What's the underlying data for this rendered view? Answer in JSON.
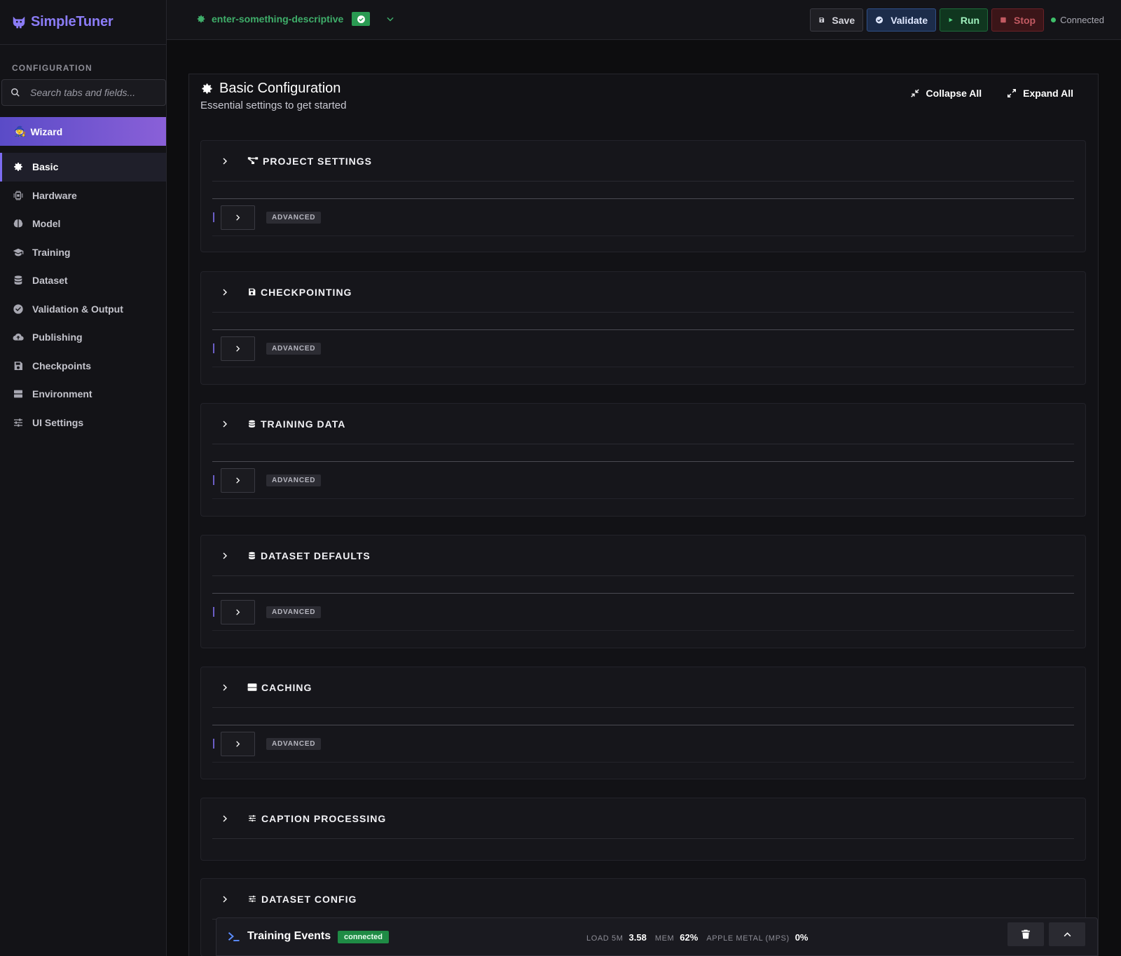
{
  "brand": {
    "name": "SimpleTuner",
    "color": "#8b7cf6"
  },
  "sidebar": {
    "section_label": "CONFIGURATION",
    "search_placeholder": "Search tabs and fields...",
    "wizard_label": "Wizard",
    "items": [
      {
        "label": "Basic",
        "icon": "gear-icon",
        "active": true
      },
      {
        "label": "Hardware",
        "icon": "chip-icon"
      },
      {
        "label": "Model",
        "icon": "brain-icon"
      },
      {
        "label": "Training",
        "icon": "graduation-cap-icon"
      },
      {
        "label": "Dataset",
        "icon": "database-icon"
      },
      {
        "label": "Validation & Output",
        "icon": "check-circle-icon"
      },
      {
        "label": "Publishing",
        "icon": "cloud-upload-icon"
      },
      {
        "label": "Checkpoints",
        "icon": "floppy-icon"
      },
      {
        "label": "Environment",
        "icon": "server-icon"
      },
      {
        "label": "UI Settings",
        "icon": "sliders-icon"
      }
    ]
  },
  "topbar": {
    "config_name": "enter-something-descriptive",
    "save_label": "Save",
    "validate_label": "Validate",
    "run_label": "Run",
    "stop_label": "Stop",
    "status_label": "Connected"
  },
  "panel": {
    "title": "Basic Configuration",
    "subtitle": "Essential settings to get started",
    "collapse_all": "Collapse All",
    "expand_all": "Expand All",
    "sections": [
      {
        "title": "PROJECT SETTINGS",
        "icon": "project-diagram-icon",
        "advanced": "ADVANCED"
      },
      {
        "title": "CHECKPOINTING",
        "icon": "floppy-icon",
        "advanced": "ADVANCED"
      },
      {
        "title": "TRAINING DATA",
        "icon": "database-icon",
        "advanced": "ADVANCED"
      },
      {
        "title": "DATASET DEFAULTS",
        "icon": "database-icon",
        "advanced": "ADVANCED"
      },
      {
        "title": "CACHING",
        "icon": "hdd-icon",
        "advanced": "ADVANCED"
      },
      {
        "title": "CAPTION PROCESSING",
        "icon": "sliders-icon"
      },
      {
        "title": "DATASET CONFIG",
        "icon": "sliders-icon"
      }
    ]
  },
  "events": {
    "title": "Training Events",
    "status": "connected",
    "load_label": "LOAD 5M",
    "load_value": "3.58",
    "mem_label": "MEM",
    "mem_value": "62%",
    "gpu_label": "APPLE METAL (MPS)",
    "gpu_value": "0%"
  }
}
